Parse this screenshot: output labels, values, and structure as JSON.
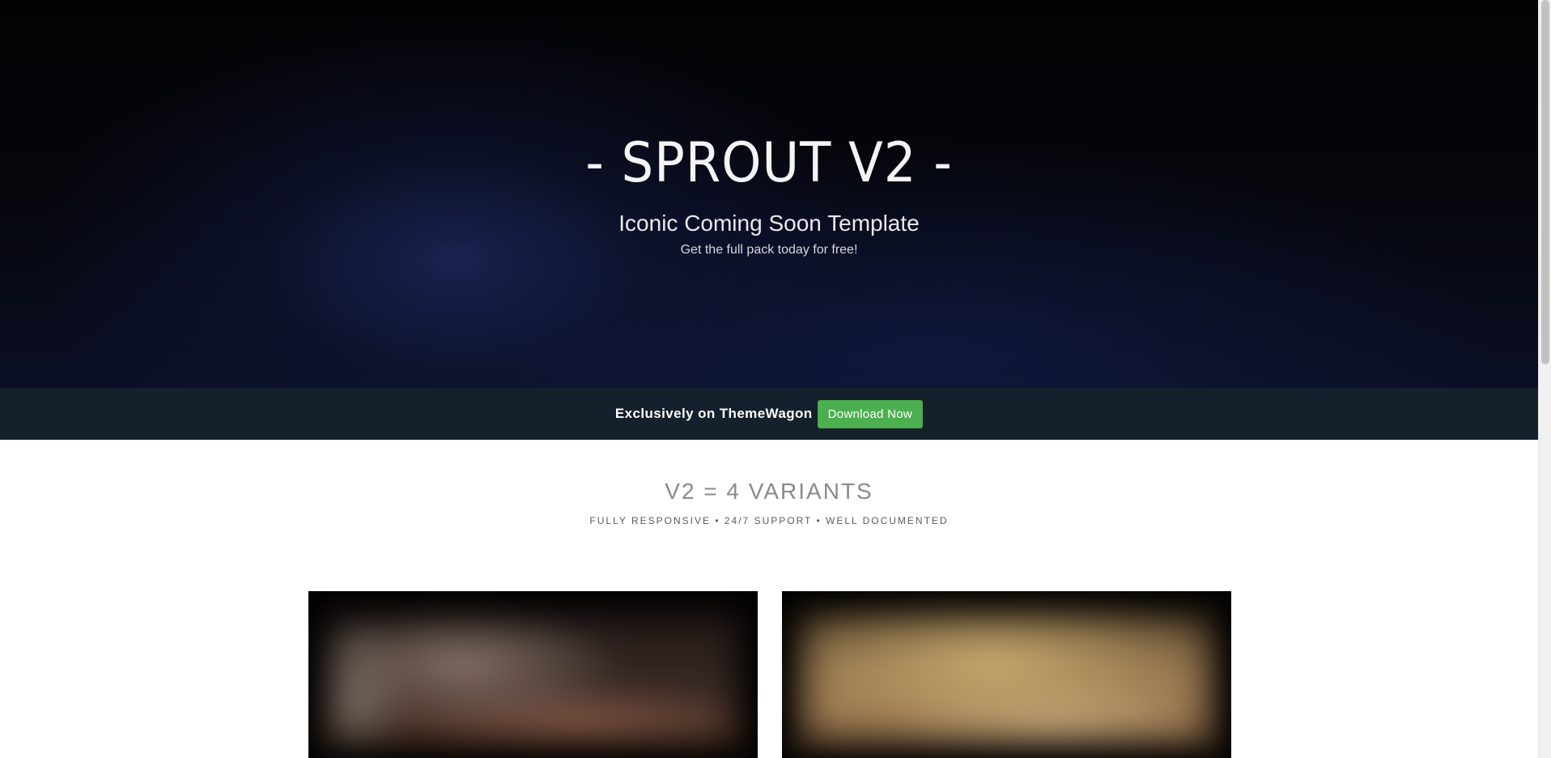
{
  "hero": {
    "title": "- SPROUT V2 -",
    "subtitle": "Iconic Coming Soon Template",
    "tagline": "Get the full pack today for free!"
  },
  "promo": {
    "text": "Exclusively on ThemeWagon",
    "button_label": "Download Now"
  },
  "variants": {
    "title": "V2 = 4 VARIANTS",
    "features": "FULLY RESPONSIVE • 24/7 SUPPORT • WELL DOCUMENTED"
  },
  "colors": {
    "hero_background": "#05060c",
    "promo_bar": "#14202b",
    "button": "#4caf50",
    "variants_title": "#8a8a8a"
  }
}
